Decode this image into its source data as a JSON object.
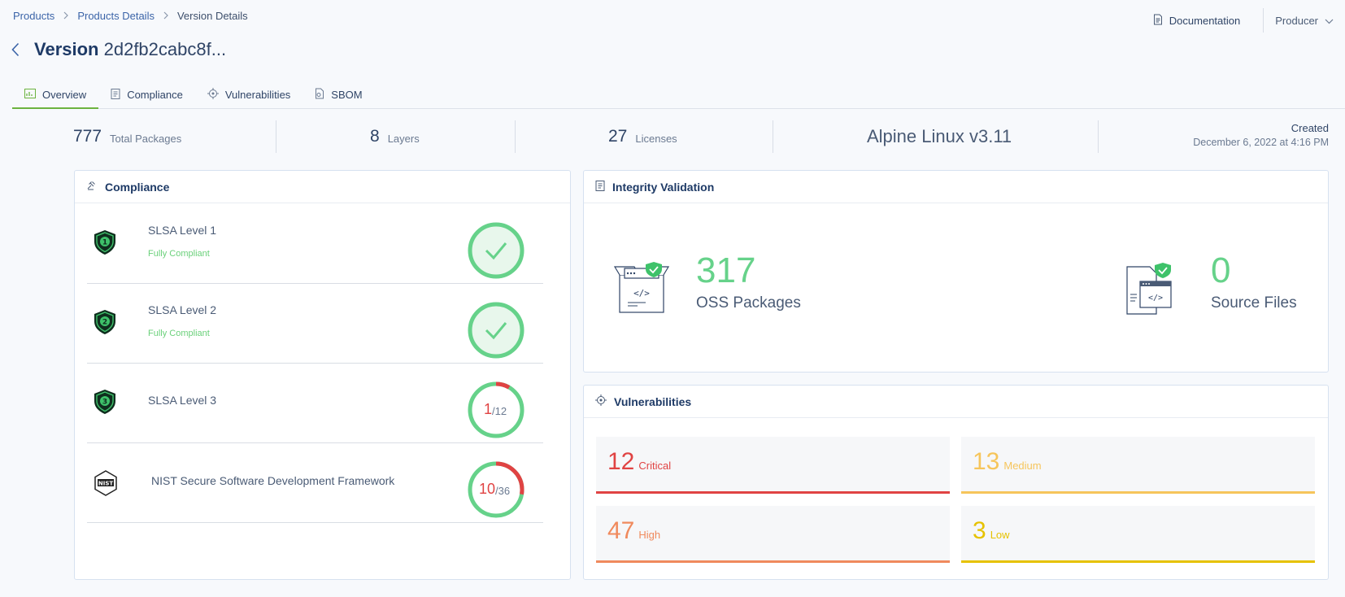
{
  "breadcrumb": {
    "item1": "Products",
    "item2": "Products Details",
    "item3": "Version Details"
  },
  "header": {
    "doc_label": "Documentation",
    "role": "Producer"
  },
  "title": {
    "prefix": "Version",
    "hash": "2d2fb2cabc8f..."
  },
  "tabs": [
    {
      "label": "Overview",
      "icon": "overview-icon",
      "active": true
    },
    {
      "label": "Compliance",
      "icon": "clipboard-icon"
    },
    {
      "label": "Vulnerabilities",
      "icon": "crosshair-icon"
    },
    {
      "label": "SBOM",
      "icon": "sbom-icon"
    }
  ],
  "stats": {
    "packages": {
      "value": "777",
      "label": "Total Packages"
    },
    "layers": {
      "value": "8",
      "label": "Layers"
    },
    "licenses": {
      "value": "27",
      "label": "Licenses"
    },
    "os": "Alpine Linux v3.11",
    "created_label": "Created",
    "created_date": "December 6, 2022 at 4:16 PM"
  },
  "compliance": {
    "title": "Compliance",
    "rows": [
      {
        "name": "SLSA Level 1",
        "status": "Fully Compliant",
        "passed": 1,
        "total": 1,
        "complete": true,
        "badge": "1"
      },
      {
        "name": "SLSA Level 2",
        "status": "Fully Compliant",
        "passed": 1,
        "total": 1,
        "complete": true,
        "badge": "2"
      },
      {
        "name": "SLSA Level 3",
        "status": "",
        "passed": 1,
        "total": 12,
        "complete": false,
        "badge": "3",
        "num": "1",
        "den": "/12"
      },
      {
        "name": "NIST Secure Software Development Framework",
        "status": "",
        "passed": 10,
        "total": 36,
        "complete": false,
        "badge": "NIST",
        "num": "10",
        "den": "/36"
      }
    ]
  },
  "integrity": {
    "title": "Integrity Validation",
    "oss_count": "317",
    "oss_label": "OSS Packages",
    "src_count": "0",
    "src_label": "Source Files"
  },
  "vulnerabilities": {
    "title": "Vulnerabilities",
    "critical": {
      "count": "12",
      "label": "Critical",
      "color": "#e04343"
    },
    "medium": {
      "count": "13",
      "label": "Medium",
      "color": "#f6c55b"
    },
    "high": {
      "count": "47",
      "label": "High",
      "color": "#f08a5d"
    },
    "low": {
      "count": "3",
      "label": "Low",
      "color": "#e6c200"
    }
  },
  "colors": {
    "accent": "#6cb33f",
    "link": "#3b64a8",
    "success": "#66d28a",
    "danger": "#e04343"
  }
}
